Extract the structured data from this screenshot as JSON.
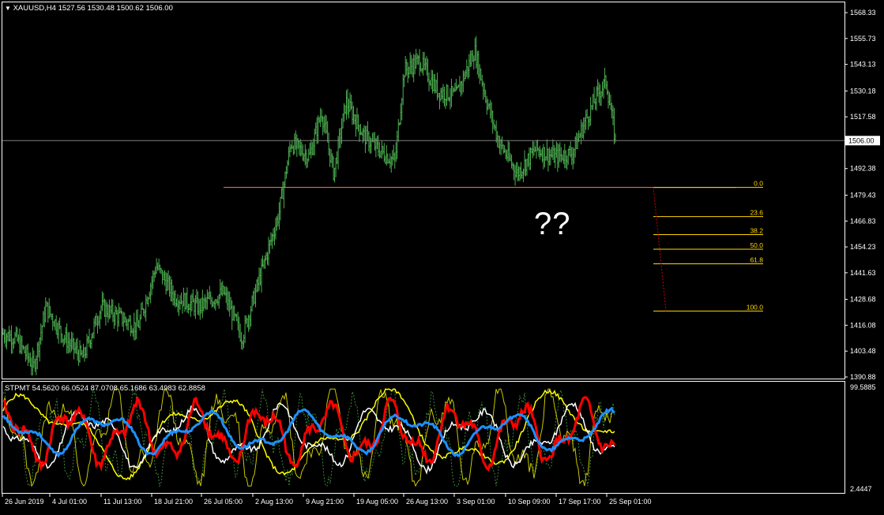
{
  "chart_header": {
    "symbol_tf": "XAUUSD,H4",
    "ohlc": "1527.56 1530.48 1500.62 1506.00"
  },
  "indicator_header": "STPMT 54.5620 66.0524 87.0708 65.1686 63.4983 62.8858",
  "annotation": "??",
  "colors": {
    "background": "#000000",
    "candles": "#4caf50",
    "grid_border": "#ffffff",
    "current_price_line": "#808080",
    "support_line": "#ff7f50",
    "fib_levels": "#ffd700",
    "fib_trend": "#cc0000",
    "stpmt_main": "#ff0000",
    "stpmt_signal": "#1e90ff",
    "stpmt_white": "#ffffff",
    "stpmt_yellow": "#ffff00",
    "stpmt_green": "#3a8a3a"
  },
  "price_axis": [
    "1568.33",
    "1555.73",
    "1543.13",
    "1530.18",
    "1517.58",
    "1492.38",
    "1479.43",
    "1466.83",
    "1454.23",
    "1441.63",
    "1428.68",
    "1416.08",
    "1403.48",
    "1390.88"
  ],
  "current_price": "1506.00",
  "indicator_axis": {
    "top": "99.5885",
    "bottom": "2.4447"
  },
  "time_axis": [
    "26 Jun 2019",
    "4 Jul 01:00",
    "11 Jul 13:00",
    "18 Jul 21:00",
    "26 Jul 05:00",
    "2 Aug 13:00",
    "9 Aug 21:00",
    "19 Aug 05:00",
    "26 Aug 13:00",
    "3 Sep 01:00",
    "10 Sep 09:00",
    "17 Sep 17:00",
    "25 Sep 01:00"
  ],
  "fibonacci": [
    {
      "level": "0.0",
      "price": 1483.2
    },
    {
      "level": "23.6",
      "price": 1469.0
    },
    {
      "level": "38.2",
      "price": 1460.2
    },
    {
      "level": "50.0",
      "price": 1453.1
    },
    {
      "level": "61.8",
      "price": 1446.0
    },
    {
      "level": "100.0",
      "price": 1423.0
    }
  ],
  "chart_data": {
    "type": "line",
    "title": "XAUUSD,H4",
    "ylim": [
      1388,
      1575
    ],
    "x": [
      "26 Jun 2019",
      "4 Jul 01:00",
      "11 Jul 13:00",
      "18 Jul 21:00",
      "26 Jul 05:00",
      "2 Aug 13:00",
      "9 Aug 21:00",
      "19 Aug 05:00",
      "26 Aug 13:00",
      "3 Sep 01:00",
      "10 Sep 09:00",
      "17 Sep 17:00",
      "25 Sep 01:00"
    ],
    "series": [
      {
        "values": [
          1408,
          1412,
          1415,
          1422,
          1428,
          1470,
          1505,
          1500,
          1540,
          1545,
          1500,
          1502,
          1506
        ]
      }
    ],
    "support_level": 1483.2,
    "fib_high": 1483.2,
    "fib_low": 1423.0
  }
}
